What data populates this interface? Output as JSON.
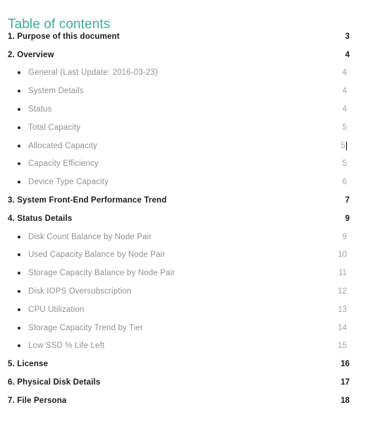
{
  "document": {
    "title": "Table of contents",
    "title_color": "#3aae9a"
  },
  "toc": {
    "entries": [
      {
        "label": "1. Purpose of this document",
        "page": "3",
        "level": 1,
        "caret": false
      },
      {
        "label": "2. Overview",
        "page": "4",
        "level": 1,
        "caret": false
      },
      {
        "label": "General (Last Update: 2016-03-23)",
        "page": "4",
        "level": 2,
        "caret": false
      },
      {
        "label": "System Details",
        "page": "4",
        "level": 2,
        "caret": false
      },
      {
        "label": "Status",
        "page": "4",
        "level": 2,
        "caret": false
      },
      {
        "label": "Total Capacity",
        "page": "5",
        "level": 2,
        "caret": false
      },
      {
        "label": "Allocated Capacity",
        "page": "5",
        "level": 2,
        "caret": true
      },
      {
        "label": "Capacity Efficiency",
        "page": "5",
        "level": 2,
        "caret": false
      },
      {
        "label": "Device Type Capacity",
        "page": "6",
        "level": 2,
        "caret": false
      },
      {
        "label": "3. System Front-End Performance Trend",
        "page": "7",
        "level": 1,
        "caret": false
      },
      {
        "label": "4. Status Details",
        "page": "9",
        "level": 1,
        "caret": false
      },
      {
        "label": "Disk Count Balance by Node Pair",
        "page": "9",
        "level": 2,
        "caret": false
      },
      {
        "label": "Used Capacity Balance by Node Pair",
        "page": "10",
        "level": 2,
        "caret": false
      },
      {
        "label": "Storage Capacity Balance by Node Pair",
        "page": "11",
        "level": 2,
        "caret": false
      },
      {
        "label": "Disk IOPS Oversubscription",
        "page": "12",
        "level": 2,
        "caret": false
      },
      {
        "label": "CPU Utilization",
        "page": "13",
        "level": 2,
        "caret": false
      },
      {
        "label": "Storage Capacity Trend by Tier",
        "page": "14",
        "level": 2,
        "caret": false
      },
      {
        "label": "Low SSD % Life Left",
        "page": "15",
        "level": 2,
        "caret": false
      },
      {
        "label": "5. License",
        "page": "16",
        "level": 1,
        "caret": false
      },
      {
        "label": "6. Physical Disk Details",
        "page": "17",
        "level": 1,
        "caret": false
      },
      {
        "label": "7. File Persona",
        "page": "18",
        "level": 1,
        "caret": false
      }
    ]
  }
}
